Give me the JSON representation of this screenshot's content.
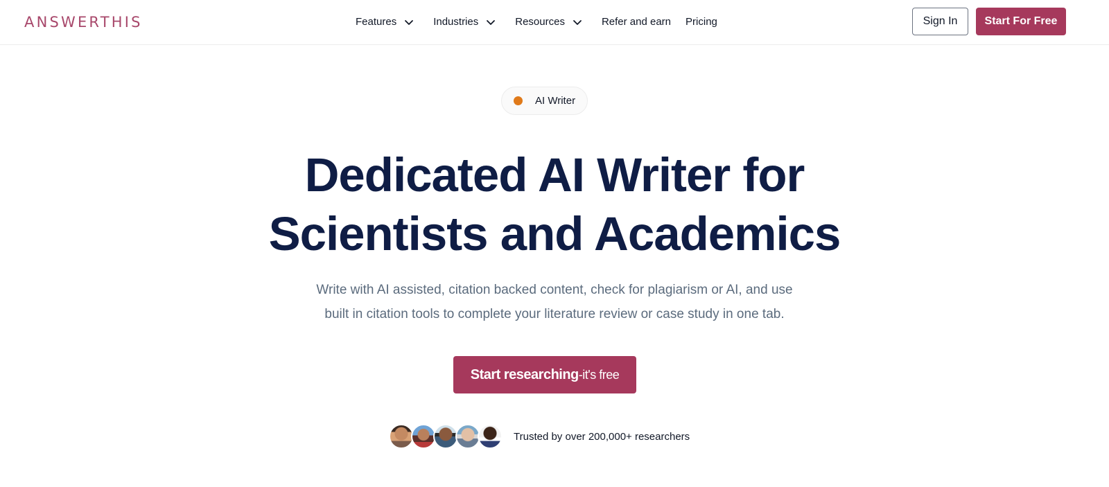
{
  "header": {
    "logo": "ANSWERTHIS",
    "nav": [
      {
        "label": "Features",
        "has_dropdown": true,
        "icon": "chevron-down-icon"
      },
      {
        "label": "Industries",
        "has_dropdown": true,
        "icon": "chevron-down-icon"
      },
      {
        "label": "Resources",
        "has_dropdown": true,
        "icon": "chevron-down-icon"
      },
      {
        "label": "Refer and earn",
        "has_dropdown": false
      },
      {
        "label": "Pricing",
        "has_dropdown": false
      }
    ],
    "sign_in_label": "Sign In",
    "start_label": "Start For Free"
  },
  "hero": {
    "badge_label": "AI Writer",
    "title_line1": "Dedicated AI Writer for",
    "title_line2": "Scientists and Academics",
    "subtitle_line1": "Write with AI assisted, citation backed content, check for plagiarism or AI, and use",
    "subtitle_line2": "built in citation tools to complete your literature review or case study in one tab.",
    "cta_main": "Start researching",
    "cta_sub": "-it's free",
    "trust_text": "Trusted by over 200,000+ researchers"
  },
  "colors": {
    "brand": "#a6395c",
    "logo": "#a8486b",
    "title": "#0f1d45",
    "subtitle": "#5b6b7d",
    "badge_dot": "#e07a1a"
  },
  "avatars": [
    {
      "icon": "researcher-avatar-1"
    },
    {
      "icon": "researcher-avatar-2"
    },
    {
      "icon": "researcher-avatar-3"
    },
    {
      "icon": "researcher-avatar-4"
    },
    {
      "icon": "researcher-avatar-5"
    }
  ]
}
